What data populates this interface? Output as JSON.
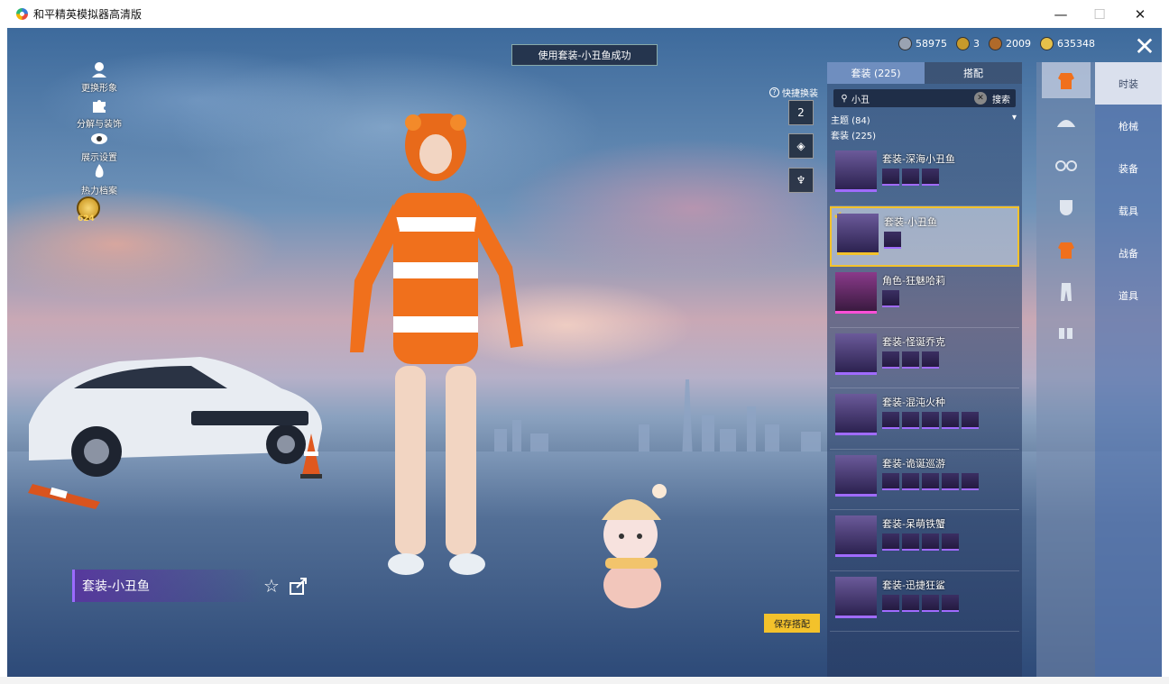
{
  "window": {
    "title": "和平精英模拟器高清版"
  },
  "toast": "使用套装-小丑鱼成功",
  "left_menu": [
    "更换形象",
    "分解与装饰",
    "展示设置",
    "热力档案"
  ],
  "level": "624",
  "currency": [
    "58975",
    "3",
    "2009",
    "635348"
  ],
  "quick_switch": {
    "label": "快捷换装",
    "slot": "2"
  },
  "panel": {
    "tabs": [
      "套装 (225)",
      "搭配"
    ],
    "search": {
      "value": "小丑",
      "button": "搜索"
    },
    "theme": "主题 (84)",
    "suit_count": "套装 (225)",
    "suits": [
      {
        "name": "套装-深海小丑鱼",
        "items": 3
      },
      {
        "name": "套装-小丑鱼",
        "items": 1,
        "selected": true
      },
      {
        "name": "角色-狂魅哈莉",
        "items": 1
      },
      {
        "name": "套装-怪诞乔克",
        "items": 3
      },
      {
        "name": "套装-混沌火种",
        "items": 5
      },
      {
        "name": "套装-诡诞巡游",
        "items": 5
      },
      {
        "name": "套装-呆萌铁蟹",
        "items": 4
      },
      {
        "name": "套装-迅捷狂鲨",
        "items": 4
      }
    ]
  },
  "outfit_name": "套装-小丑鱼",
  "save_label": "保存搭配",
  "side_menu": [
    "时装",
    "枪械",
    "装备",
    "载具",
    "战备",
    "道具"
  ],
  "colors": {
    "accent": "#f3c22b",
    "purple": "#a06bff"
  }
}
